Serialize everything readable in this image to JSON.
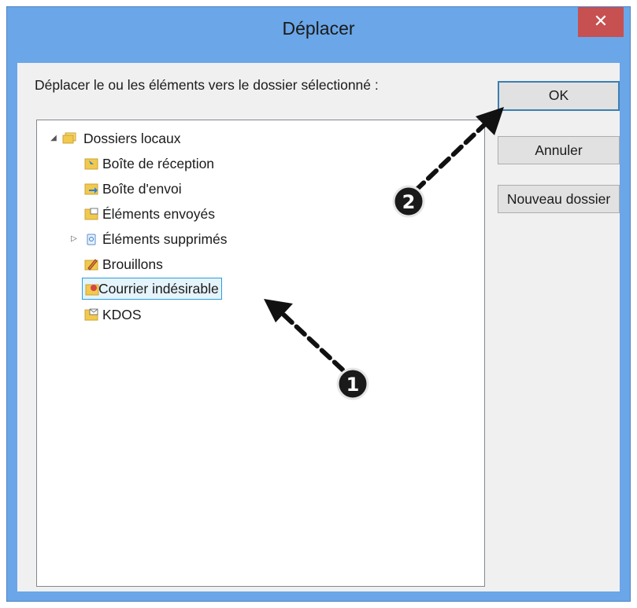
{
  "window": {
    "title": "Déplacer",
    "close_glyph": "✕"
  },
  "dialog": {
    "prompt": "Déplacer le ou les éléments vers le dossier sélectionné :",
    "buttons": {
      "ok": "OK",
      "cancel": "Annuler",
      "new_folder": "Nouveau dossier"
    }
  },
  "tree": {
    "root": {
      "label": "Dossiers locaux",
      "expander": "◢",
      "icon": "folders-icon"
    },
    "items": [
      {
        "label": "Boîte de réception",
        "icon": "inbox-folder-icon"
      },
      {
        "label": "Boîte d'envoi",
        "icon": "outbox-folder-icon"
      },
      {
        "label": "Éléments envoyés",
        "icon": "sent-folder-icon"
      },
      {
        "label": "Éléments supprimés",
        "icon": "recycle-folder-icon",
        "expander": "▷"
      },
      {
        "label": "Brouillons",
        "icon": "drafts-folder-icon"
      },
      {
        "label": "Courrier indésirable",
        "icon": "junk-folder-icon",
        "selected": true
      },
      {
        "label": "KDOS",
        "icon": "mail-folder-icon"
      }
    ]
  },
  "annotations": {
    "step1": "1",
    "step2": "2"
  },
  "colors": {
    "titlebar": "#6aa6e8",
    "close": "#c75050",
    "selection_border": "#26a0da",
    "selection_fill": "#e5f3fb",
    "folder": "#f2c94c"
  }
}
